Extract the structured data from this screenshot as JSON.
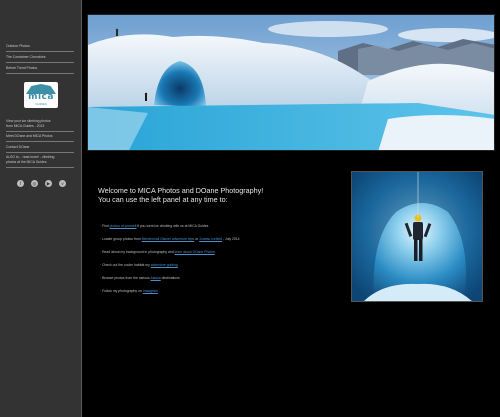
{
  "colors": {
    "sidebar_bg": "#333333",
    "main_bg": "#000000",
    "link": "#4a8fc8",
    "logo_brand": "#3d8fa8",
    "ice_blue": "#4fb8e0"
  },
  "sidebar": {
    "links": [
      "Outdoor Photos",
      "The Conrtainer Chronicles",
      "Before Trend Photos"
    ],
    "logo": {
      "text": "mica",
      "subtext": "GUIDES",
      "icon": "mica-logo"
    },
    "info_lines": [
      "View your ice climbing photos",
      "from MICA Guides - 2013",
      "Meet DOane and MICA Photos"
    ],
    "contact_label": "Contact DOane",
    "extra_lines": [
      "ALSO to... read more! - climbing",
      "photos at the MICA Guides"
    ],
    "social_icons": [
      "facebook-icon",
      "instagram-icon",
      "youtube-icon",
      "vimeo-icon"
    ]
  },
  "hero": {
    "image": "glacier-ice-cave-with-climbers"
  },
  "welcome": {
    "line1": "Welcome to MICA Photos and DOane Photography!",
    "line2": "You can use the left panel at any time to:"
  },
  "bullets": [
    {
      "pre": "Find ",
      "link": "photos of yourself",
      "post": " if you went ice climbing with us at MICA Guides"
    },
    {
      "pre": "Locate group photos from ",
      "link": "Mendenhall Glacier adventure trips",
      "mid": " or ",
      "link2": "Juneau Icefield",
      "post": " - July 2014"
    },
    {
      "pre": "Read about my background in photography and ",
      "link": "learn about DOane Photos",
      "post": ""
    },
    {
      "pre": "Check out the cooler habitat my ",
      "link": "adventure guiding",
      "post": ""
    },
    {
      "pre": "Browse photos from the various ",
      "link": "Alaska",
      "post": " destinations"
    },
    {
      "pre": "Follow my photography on ",
      "link": "Instagram",
      "post": ""
    }
  ],
  "side_photo": {
    "image": "climber-inside-ice-cave"
  }
}
